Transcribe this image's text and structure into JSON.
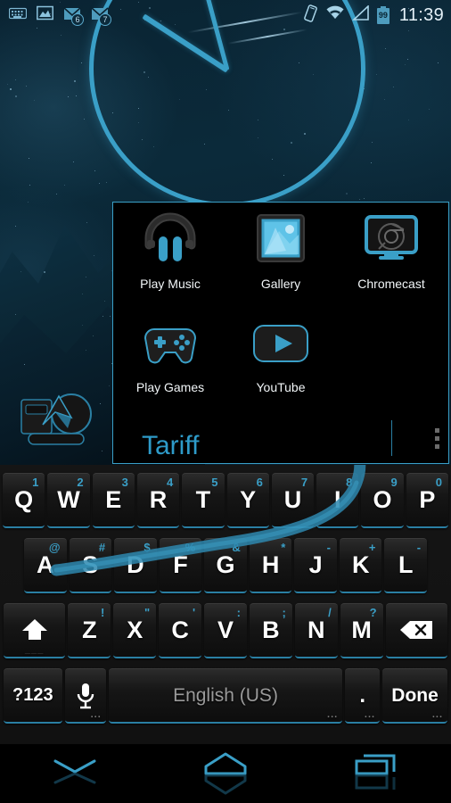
{
  "status_bar": {
    "left_icons": [
      {
        "name": "keyboard-icon",
        "label": "keyboard"
      },
      {
        "name": "photo-icon",
        "label": "image"
      },
      {
        "name": "message-icon-1",
        "label": "message",
        "badge": "6"
      },
      {
        "name": "message-icon-2",
        "label": "message",
        "badge": "7"
      }
    ],
    "right_icons": [
      {
        "name": "vibrate-icon",
        "label": "vibrate"
      },
      {
        "name": "wifi-icon",
        "label": "wifi"
      },
      {
        "name": "signal-icon",
        "label": "signal"
      },
      {
        "name": "battery-icon",
        "label": "battery",
        "level": "99"
      }
    ],
    "clock": "11:39"
  },
  "app_panel": {
    "apps": [
      {
        "label": "Play Music",
        "icon": "headphones-icon"
      },
      {
        "label": "Gallery",
        "icon": "gallery-icon"
      },
      {
        "label": "Chromecast",
        "icon": "chromecast-icon"
      },
      {
        "label": "Play Games",
        "icon": "gamepad-icon"
      },
      {
        "label": "YouTube",
        "icon": "youtube-icon"
      }
    ],
    "overflow_label": "More options"
  },
  "word_preview": {
    "text": "Tariff"
  },
  "keyboard": {
    "row1": [
      {
        "key": "Q",
        "alt": "1"
      },
      {
        "key": "W",
        "alt": "2"
      },
      {
        "key": "E",
        "alt": "3"
      },
      {
        "key": "R",
        "alt": "4"
      },
      {
        "key": "T",
        "alt": "5"
      },
      {
        "key": "Y",
        "alt": "6"
      },
      {
        "key": "U",
        "alt": "7"
      },
      {
        "key": "I",
        "alt": "8"
      },
      {
        "key": "O",
        "alt": "9"
      },
      {
        "key": "P",
        "alt": "0"
      }
    ],
    "row2": [
      {
        "key": "A",
        "alt": "@"
      },
      {
        "key": "S",
        "alt": "#"
      },
      {
        "key": "D",
        "alt": "$"
      },
      {
        "key": "F",
        "alt": "%"
      },
      {
        "key": "G",
        "alt": "&"
      },
      {
        "key": "H",
        "alt": "*"
      },
      {
        "key": "J",
        "alt": "-"
      },
      {
        "key": "K",
        "alt": "+"
      },
      {
        "key": "L",
        "alt": "-"
      }
    ],
    "row3": [
      {
        "key": "Z",
        "alt": "!"
      },
      {
        "key": "X",
        "alt": "\""
      },
      {
        "key": "C",
        "alt": "'"
      },
      {
        "key": "V",
        "alt": ":"
      },
      {
        "key": "B",
        "alt": ";"
      },
      {
        "key": "N",
        "alt": "/"
      },
      {
        "key": "M",
        "alt": "?"
      }
    ],
    "shift_label": "shift",
    "backspace_label": "backspace",
    "symbols_label": "?123",
    "mic_label": "voice input",
    "space_label": "English (US)",
    "period_label": ".",
    "done_label": "Done",
    "long_press_hint": "..."
  },
  "nav_bar": {
    "back_label": "Back",
    "home_label": "Home",
    "recents_label": "Recents"
  },
  "colors": {
    "accent": "#3a9fc7",
    "key_underline": "#2a7fa3",
    "panel_border": "#3a9fc7",
    "text_primary": "#ffffff",
    "keyboard_bg": "#151515"
  }
}
